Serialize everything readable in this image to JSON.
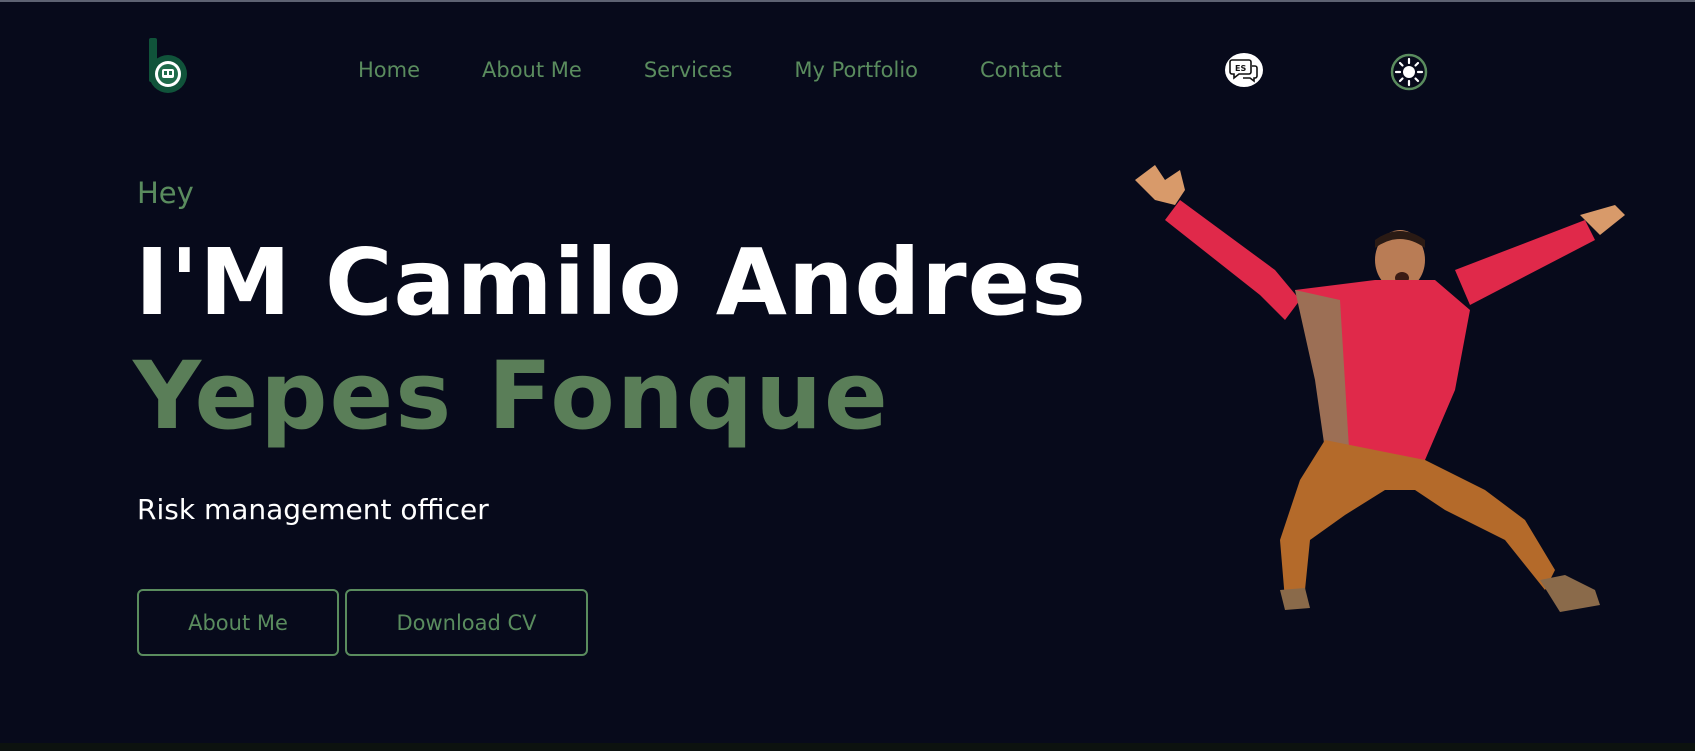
{
  "header": {
    "logo_icon": "b-logo-icon",
    "nav": [
      {
        "label": "Home"
      },
      {
        "label": "About Me"
      },
      {
        "label": "Services"
      },
      {
        "label": "My Portfolio"
      },
      {
        "label": "Contact"
      }
    ],
    "lang_button": {
      "label": "ES",
      "icon": "chat-bubbles-icon"
    },
    "theme_toggle": {
      "icon": "sun-icon"
    }
  },
  "hero": {
    "greeting": "Hey",
    "name_line1": "I'M Camilo Andres",
    "name_line2": "Yepes Fonque",
    "role": "Risk management officer",
    "buttons": {
      "about": "About Me",
      "cv": "Download CV"
    },
    "photo": "jumping-person-photo"
  },
  "colors": {
    "background": "#070a1b",
    "accent": "#5a8c5e",
    "text": "#ffffff"
  }
}
